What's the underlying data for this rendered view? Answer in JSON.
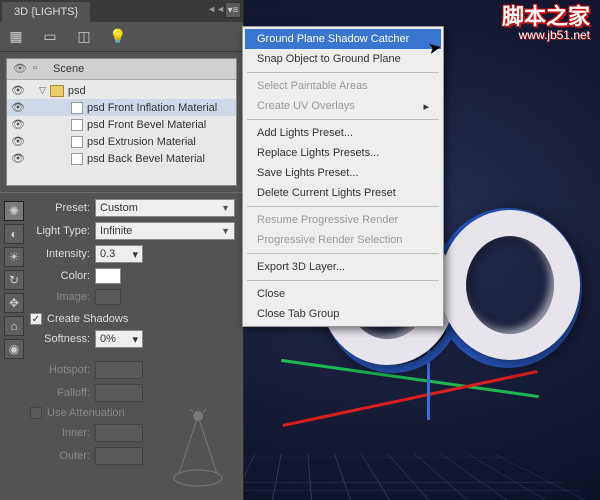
{
  "watermark": {
    "title": "脚本之家",
    "url": "www.jb51.net"
  },
  "panel": {
    "tab": "3D {LIGHTS}",
    "scene": {
      "header": "Scene",
      "root": "psd",
      "materials": [
        "psd Front Inflation Material",
        "psd Front Bevel Material",
        "psd Extrusion Material",
        "psd Back Bevel Material"
      ]
    },
    "props": {
      "preset_label": "Preset:",
      "preset_value": "Custom",
      "lighttype_label": "Light Type:",
      "lighttype_value": "Infinite",
      "intensity_label": "Intensity:",
      "intensity_value": "0.3",
      "color_label": "Color:",
      "image_label": "Image:",
      "create_shadows": "Create Shadows",
      "create_shadows_checked": "✓",
      "softness_label": "Softness:",
      "softness_value": "0%",
      "hotspot_label": "Hotspot:",
      "falloff_label": "Falloff:",
      "attenuation_label": "Use Attenuation",
      "inner_label": "Inner:",
      "outer_label": "Outer:"
    }
  },
  "menu": {
    "items": [
      {
        "t": "Ground Plane Shadow Catcher",
        "hl": true
      },
      {
        "t": "Snap Object to Ground Plane"
      },
      {
        "sep": true
      },
      {
        "t": "Select Paintable Areas",
        "dim": true
      },
      {
        "t": "Create UV Overlays",
        "dim": true,
        "sub": true
      },
      {
        "sep": true
      },
      {
        "t": "Add Lights Preset..."
      },
      {
        "t": "Replace Lights Presets..."
      },
      {
        "t": "Save Lights Preset..."
      },
      {
        "t": "Delete Current Lights Preset"
      },
      {
        "sep": true
      },
      {
        "t": "Resume Progressive Render",
        "dim": true
      },
      {
        "t": "Progressive Render Selection",
        "dim": true
      },
      {
        "sep": true
      },
      {
        "t": "Export 3D Layer..."
      },
      {
        "sep": true
      },
      {
        "t": "Close"
      },
      {
        "t": "Close Tab Group"
      }
    ]
  }
}
